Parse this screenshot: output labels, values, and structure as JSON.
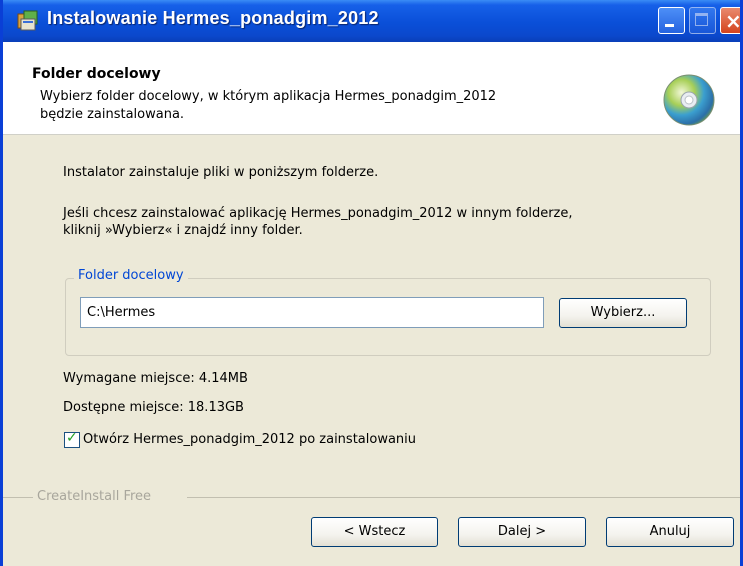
{
  "window": {
    "title": "Instalowanie Hermes_ponadgim_2012",
    "icons": {
      "app": "installer-icon",
      "minimize": "minimize-icon",
      "maximize": "maximize-icon",
      "close": "close-icon"
    }
  },
  "header": {
    "title": "Folder docelowy",
    "description_line1": "Wybierz folder docelowy, w którym aplikacja Hermes_ponadgim_2012",
    "description_line2": "będzie zainstalowana.",
    "icon": "cd-disc-icon"
  },
  "body": {
    "intro": "Instalator zainstaluje pliki w poniższym folderze.",
    "instruction_line1": "Jeśli chcesz zainstalować aplikację Hermes_ponadgim_2012 w innym folderze,",
    "instruction_line2": "kliknij »Wybierz« i znajdź inny folder."
  },
  "folder_group": {
    "legend": "Folder docelowy",
    "path_value": "C:\\Hermes",
    "browse_label": "Wybierz..."
  },
  "space": {
    "required": "Wymagane miejsce: 4.14MB",
    "available": "Dostępne miejsce: 18.13GB"
  },
  "launch_option": {
    "label": "Otwórz Hermes_ponadgim_2012 po zainstalowaniu",
    "checked": true
  },
  "footer": {
    "brand": "CreateInstall Free",
    "back_label": "< Wstecz",
    "next_label": "Dalej >",
    "cancel_label": "Anuluj"
  },
  "colors": {
    "titlebar": "#0a4fd8",
    "dialog_bg": "#ece9d8",
    "legend_text": "#0046d5",
    "check_mark": "#21a121"
  }
}
